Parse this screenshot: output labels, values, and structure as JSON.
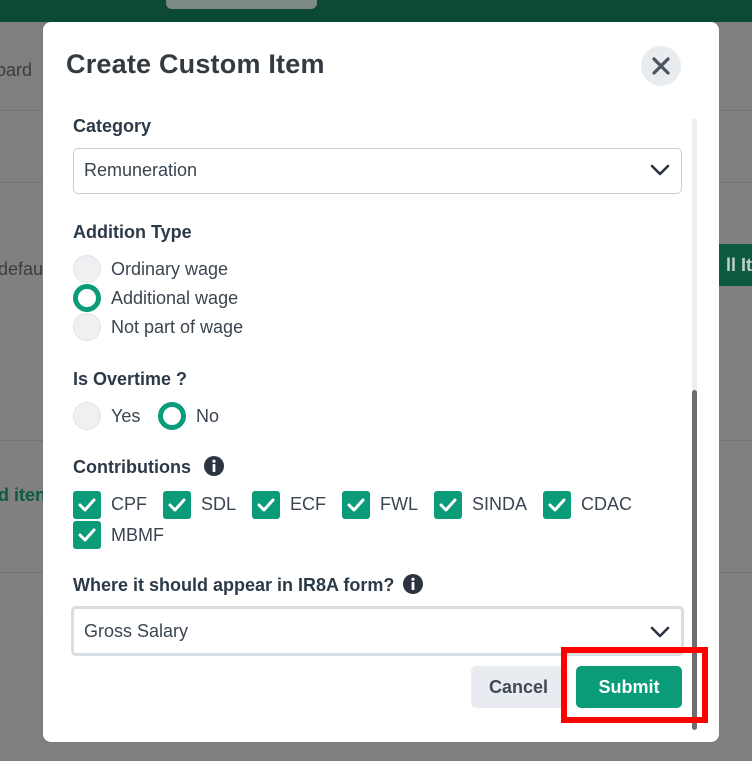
{
  "background": {
    "left_texts": [
      "oard",
      "defau",
      "d iten"
    ],
    "right_button_label": "ll Ite"
  },
  "modal": {
    "title": "Create Custom Item",
    "category": {
      "label": "Category",
      "value": "Remuneration"
    },
    "addition_type": {
      "label": "Addition Type",
      "options": [
        "Ordinary wage",
        "Additional wage",
        "Not part of wage"
      ],
      "selected": "Additional wage"
    },
    "is_overtime": {
      "label": "Is Overtime ?",
      "options": [
        "Yes",
        "No"
      ],
      "selected": "No"
    },
    "contributions": {
      "label": "Contributions",
      "items": [
        {
          "label": "CPF",
          "checked": true
        },
        {
          "label": "SDL",
          "checked": true
        },
        {
          "label": "ECF",
          "checked": true
        },
        {
          "label": "FWL",
          "checked": true
        },
        {
          "label": "SINDA",
          "checked": true
        },
        {
          "label": "CDAC",
          "checked": true
        },
        {
          "label": "MBMF",
          "checked": true
        }
      ]
    },
    "ir8a": {
      "label": "Where it should appear in IR8A form?",
      "value": "Gross Salary"
    },
    "buttons": {
      "cancel": "Cancel",
      "submit": "Submit"
    }
  },
  "colors": {
    "accent": "#0a9b78",
    "highlight": "#ff0000",
    "topbar": "#0d4a35"
  },
  "icons": [
    "close-icon",
    "chevron-down-icon",
    "info-icon",
    "check-icon"
  ]
}
